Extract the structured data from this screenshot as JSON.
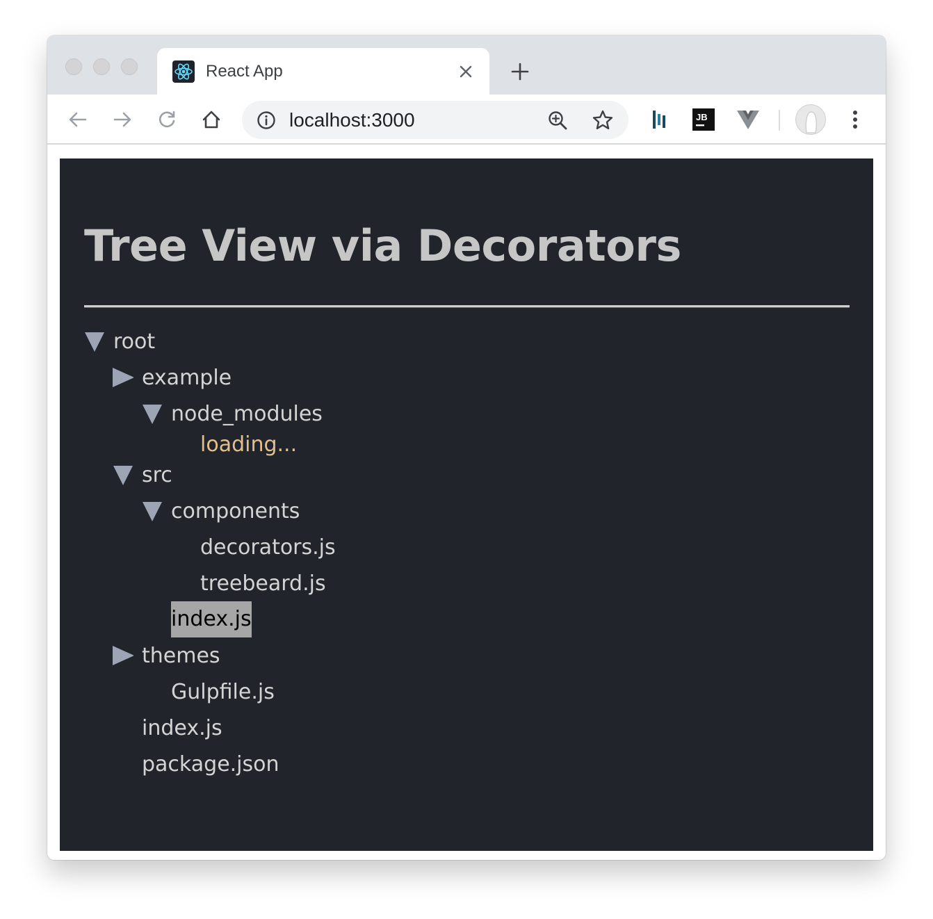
{
  "browser": {
    "tab": {
      "title": "React App",
      "favicon": "react-logo-icon"
    },
    "address_bar": {
      "url": "localhost:3000",
      "info_icon": "info-icon",
      "zoom_icon": "zoom-in-icon",
      "bookmark_icon": "star-icon"
    },
    "extensions": [
      {
        "name": "dashlane-icon"
      },
      {
        "name": "jetbrains-icon",
        "label": "JB"
      },
      {
        "name": "vue-devtools-icon"
      }
    ],
    "colors": {
      "tabstrip": "#dee1e6",
      "page_bg": "#21252b",
      "heading": "#c6c6c6",
      "tree_text": "#d4d4d4",
      "loading": "#e2c08d",
      "active_bg": "#a6a6a6",
      "toggle": "#9da5b4"
    }
  },
  "page": {
    "title": "Tree View via Decorators",
    "tree": [
      {
        "label": "root",
        "toggle": "expanded"
      },
      {
        "label": "example",
        "toggle": "collapsed"
      },
      {
        "label": "node_modules",
        "toggle": "expanded"
      },
      {
        "label": "loading...",
        "toggle": "none",
        "loading": true
      },
      {
        "label": "src",
        "toggle": "expanded"
      },
      {
        "label": "components",
        "toggle": "expanded"
      },
      {
        "label": "decorators.js",
        "toggle": "none"
      },
      {
        "label": "treebeard.js",
        "toggle": "none"
      },
      {
        "label": "index.js",
        "toggle": "none",
        "active": true
      },
      {
        "label": "themes",
        "toggle": "collapsed"
      },
      {
        "label": "Gulpfile.js",
        "toggle": "none"
      },
      {
        "label": "index.js",
        "toggle": "none"
      },
      {
        "label": "package.json",
        "toggle": "none"
      }
    ]
  }
}
